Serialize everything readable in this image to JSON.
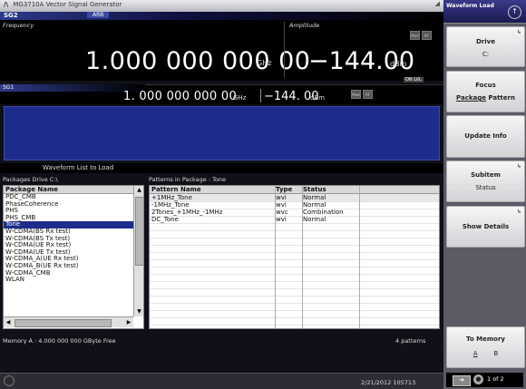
{
  "window": {
    "title": "MG3710A Vector Signal Generator",
    "logo": "/\\"
  },
  "sg2": {
    "name": "SG2",
    "mode": "ARB",
    "frequency_label": "Frequency",
    "frequency_value": "1.000 000 000 00",
    "frequency_unit": "GHz",
    "amplitude_label": "Amplitude",
    "amplitude_value": "−144.00",
    "amplitude_unit": "dBm",
    "mod_label": "Mod",
    "rf_label": "RF",
    "level_tag": "ON LVL"
  },
  "sg1": {
    "name": "SG1",
    "frequency_value": "1. 000 000 000 00",
    "frequency_unit": "GHz",
    "amplitude_value": "−144. 00",
    "amplitude_unit": "dBm",
    "mod_label": "Mod",
    "rf_label": "RF"
  },
  "waveform_list": {
    "title": "Waveform List to Load",
    "packages_drive": "Packages   Drive  C:\\",
    "patterns_in_package": "Patterns in Package : Tone",
    "package_header": "Package Name",
    "packages": [
      {
        "name": "PDC_CMB",
        "selected": false
      },
      {
        "name": "PhaseCoherence",
        "selected": false
      },
      {
        "name": "PHS",
        "selected": false
      },
      {
        "name": "PHS_CMB",
        "selected": false
      },
      {
        "name": "Tone",
        "selected": true
      },
      {
        "name": "W-CDMA(BS Rx test)",
        "selected": false
      },
      {
        "name": "W-CDMA(BS Tx test)",
        "selected": false
      },
      {
        "name": "W-CDMA(UE Rx test)",
        "selected": false
      },
      {
        "name": "W-CDMA(UE Tx test)",
        "selected": false
      },
      {
        "name": "W-CDMA_A(UE Rx test)",
        "selected": false
      },
      {
        "name": "W-CDMA_B(UE Rx test)",
        "selected": false
      },
      {
        "name": "W-CDMA_CMB",
        "selected": false
      },
      {
        "name": "WLAN",
        "selected": false
      }
    ],
    "pattern_headers": {
      "name": "Pattern Name",
      "type": "Type",
      "status": "Status"
    },
    "patterns": [
      {
        "name": "+1MHz_Tone",
        "type": "wvi",
        "status": "Normal"
      },
      {
        "name": "-1MHz_Tone",
        "type": "wvi",
        "status": "Normal"
      },
      {
        "name": "2Tones_+1MHz_-1MHz",
        "type": "wvc",
        "status": "Combination"
      },
      {
        "name": "DC_Tone",
        "type": "wvi",
        "status": "Normal"
      }
    ],
    "memory_info": "Memory A :   4.000 000 000 GByte Free",
    "pattern_count": "4 patterns"
  },
  "status_bar": {
    "datetime": "2/21/2012 105713"
  },
  "softkeys": {
    "header": "Waveform Load",
    "drive": {
      "label": "Drive",
      "value": "C:"
    },
    "focus": {
      "label": "Focus",
      "opt1": "Package",
      "opt2": "Pattern"
    },
    "update_info": "Update Info",
    "subitem": {
      "label": "Subitem",
      "value": "Status"
    },
    "show_details": "Show Details",
    "to_memory": {
      "label": "To Memory",
      "opt1": "A",
      "opt2": "B"
    },
    "page": "1 of 2"
  }
}
